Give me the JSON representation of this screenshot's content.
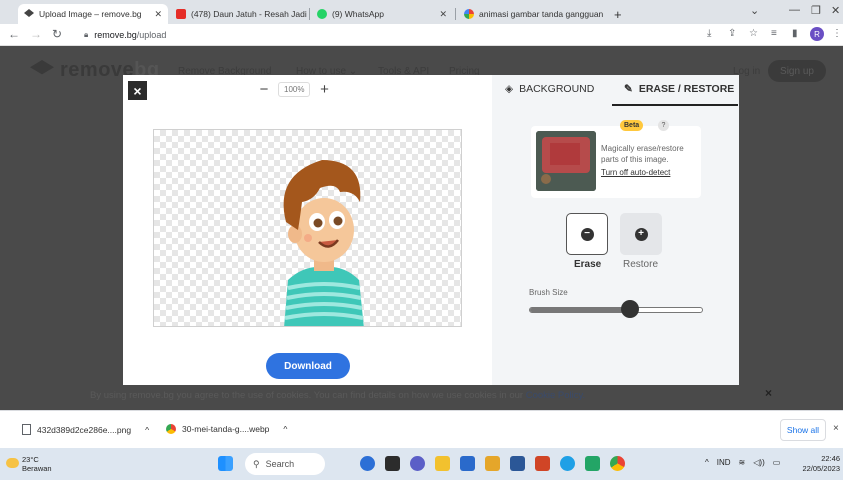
{
  "browser": {
    "tabs": [
      {
        "title": "Upload Image – remove.bg",
        "active": true
      },
      {
        "title": "(478) Daun Jatuh - Resah Jadi",
        "active": false
      },
      {
        "title": "(9) WhatsApp",
        "active": false
      },
      {
        "title": "animasi gambar tanda gangguan",
        "active": false
      }
    ],
    "new_tab": "+",
    "url_domain": "remove.bg",
    "url_path": "/upload",
    "profile_initial": "R"
  },
  "site": {
    "logo_text": "remove",
    "logo_faded": "bg",
    "nav": [
      "Remove Background",
      "How to use ⌄",
      "Tools & API",
      "Pricing"
    ],
    "login": "Log in",
    "signup": "Sign up",
    "cookie_text": "By using remove.bg you agree to the use of cookies. You can find details on how we use cookies in our",
    "cookie_link": "Cookie Policy.",
    "cookie_close": "×"
  },
  "editor": {
    "close": "×",
    "zoom_minus": "−",
    "zoom_value": "100%",
    "zoom_plus": "+",
    "download": "Download",
    "tabs": {
      "background": "BACKGROUND",
      "erase_restore": "ERASE / RESTORE"
    },
    "magic": {
      "badge": "Beta",
      "help": "?",
      "description": "Magically erase/restore parts of this image.",
      "link": "Turn off auto-detect"
    },
    "modes": [
      {
        "label": "Erase",
        "glyph": "−",
        "active": true
      },
      {
        "label": "Restore",
        "glyph": "+",
        "active": false
      }
    ],
    "brush_label": "Brush Size",
    "brush_level": 0.6
  },
  "downloads": [
    {
      "name": "432d389d2ce286e....png",
      "caret": "^"
    },
    {
      "name": "30-mei-tanda-g....webp",
      "caret": "^"
    }
  ],
  "downloads_show_all": "Show all",
  "downloads_close": "×",
  "taskbar": {
    "temperature": "23°C",
    "weather": "Berawan",
    "search": "Search",
    "lang": "IND",
    "time": "22:46",
    "date": "22/05/2023"
  },
  "colors": {
    "download_blue": "#2f73e0",
    "beta_yellow": "#ffc83d",
    "tab_youtube": "#e52d27",
    "tab_whatsapp": "#25d366"
  }
}
